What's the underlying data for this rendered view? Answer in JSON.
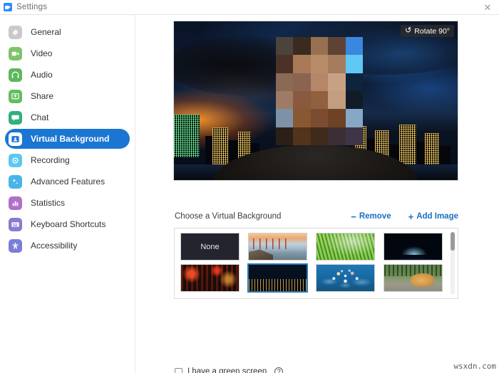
{
  "window": {
    "title": "Settings",
    "logo_icon": "zoom-logo-icon",
    "close_icon": "✕"
  },
  "sidebar": {
    "items": [
      {
        "label": "General",
        "icon": "gear-icon",
        "color": "#c9c9c9",
        "active": false
      },
      {
        "label": "Video",
        "icon": "video-camera-icon",
        "color": "#7ec46a",
        "active": false
      },
      {
        "label": "Audio",
        "icon": "headphones-icon",
        "color": "#5cb85c",
        "active": false
      },
      {
        "label": "Share",
        "icon": "share-screen-icon",
        "color": "#62bd5e",
        "active": false
      },
      {
        "label": "Chat",
        "icon": "chat-bubble-icon",
        "color": "#33b07a",
        "active": false
      },
      {
        "label": "Virtual Background",
        "icon": "person-card-icon",
        "color": "#1a76d2",
        "active": true
      },
      {
        "label": "Recording",
        "icon": "record-circle-icon",
        "color": "#5bc8f0",
        "active": false
      },
      {
        "label": "Advanced Features",
        "icon": "sparkle-icon",
        "color": "#49b4e8",
        "active": false
      },
      {
        "label": "Statistics",
        "icon": "bar-chart-icon",
        "color": "#b070c8",
        "active": false
      },
      {
        "label": "Keyboard Shortcuts",
        "icon": "keyboard-icon",
        "color": "#8a7ad0",
        "active": false
      },
      {
        "label": "Accessibility",
        "icon": "accessibility-icon",
        "color": "#7b7ed6",
        "active": false
      }
    ]
  },
  "preview": {
    "rotate_label": "Rotate 90°",
    "rotate_icon": "rotate-icon",
    "alt": "Night city skyline virtual background with pixelated face"
  },
  "choose": {
    "label": "Choose a Virtual Background",
    "remove_label": "Remove",
    "remove_symbol": "−",
    "add_label": "Add Image",
    "add_symbol": "+"
  },
  "thumbnails": [
    {
      "name": "None",
      "kind": "none",
      "selected": false
    },
    {
      "name": "Golden Gate Bridge",
      "kind": "sf",
      "selected": false
    },
    {
      "name": "Green Grass",
      "kind": "grass",
      "selected": false
    },
    {
      "name": "Earth from Space",
      "kind": "earth",
      "selected": false
    },
    {
      "name": "Night Street",
      "kind": "street",
      "selected": false
    },
    {
      "name": "Night City Skyline",
      "kind": "city",
      "selected": true
    },
    {
      "name": "World Network Map",
      "kind": "net",
      "selected": false
    },
    {
      "name": "Dog on Grass",
      "kind": "dog",
      "selected": false
    }
  ],
  "green_screen": {
    "label": "I have a green screen",
    "checked": false,
    "help_icon": "?"
  },
  "watermark": "wsxdn.com",
  "pixel_face": [
    "#4b433c",
    "#3a2a1f",
    "#96704f",
    "#5e4334",
    "#3b87dd",
    "#4a3326",
    "#a97a57",
    "#b98c68",
    "#a67c5e",
    "#5fc8f5",
    "#8a6a55",
    "#8a6450",
    "#b4866a",
    "#c7a183",
    "#0e243c",
    "#9d7b66",
    "#8a5a3e",
    "#91603f",
    "#c29d80",
    "#111c26",
    "#7d92a6",
    "#8a5733",
    "#7b4c30",
    "#6d4226",
    "#86a8c6",
    "#2b2018",
    "#52331c",
    "#402a1a",
    "#3b2f35",
    "#3e3648"
  ],
  "colors": {
    "accent": "#1a76d2",
    "link": "#1a6fc4",
    "selected_outline": "#2878b8",
    "sidebar_border": "#e9e9e9",
    "text": "#333333"
  }
}
